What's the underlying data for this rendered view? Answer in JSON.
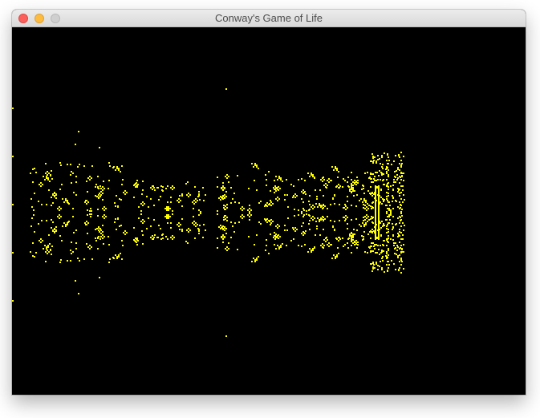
{
  "window": {
    "title": "Conway's Game of Life"
  },
  "colors": {
    "background": "#000000",
    "live_cell": "#ffff00",
    "titlebar": "#e3e3e3"
  },
  "icons": {
    "close": "close-icon",
    "minimize": "minimize-icon",
    "zoom": "zoom-icon"
  }
}
